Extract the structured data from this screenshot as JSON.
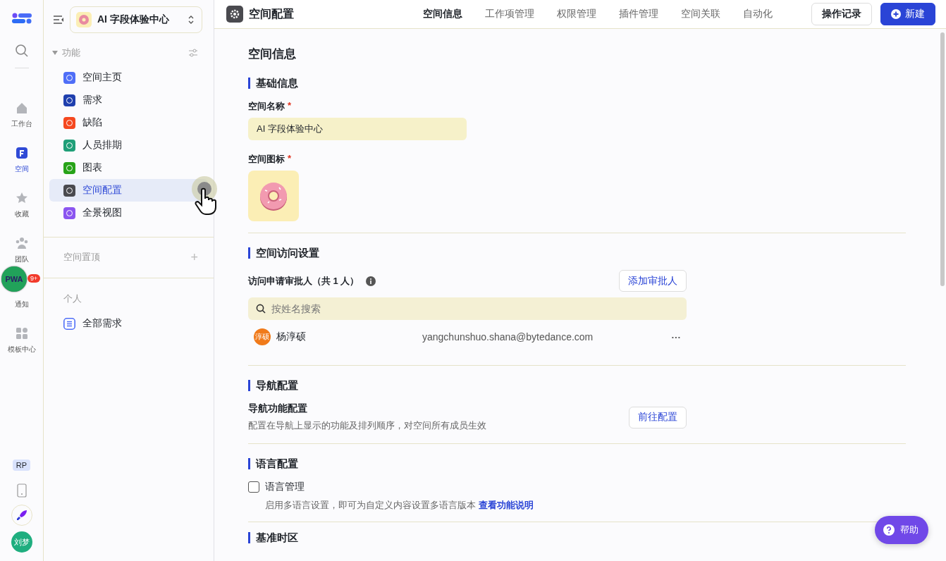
{
  "rail": {
    "items": [
      {
        "label": "工作台",
        "selected": false
      },
      {
        "label": "空间",
        "selected": true
      },
      {
        "label": "收藏",
        "selected": false
      },
      {
        "label": "团队",
        "selected": false
      },
      {
        "label": "通知",
        "selected": false,
        "badge": "9+"
      },
      {
        "label": "模板中心",
        "selected": false
      }
    ],
    "tag": "RP",
    "avatar": "刘梦"
  },
  "overlay": {
    "label": "PWA"
  },
  "space_switcher": {
    "name": "AI 字段体验中心"
  },
  "nav": {
    "sections": [
      {
        "title": "功能",
        "expanded": true,
        "items": [
          {
            "label": "空间主页",
            "kind": "filled",
            "color": "#4f6ef7",
            "selected": false
          },
          {
            "label": "需求",
            "kind": "filled",
            "color": "#1f3fae",
            "selected": false
          },
          {
            "label": "缺陷",
            "kind": "filled",
            "color": "#f5481f",
            "selected": false
          },
          {
            "label": "人员排期",
            "kind": "filled",
            "color": "#1f9f78",
            "selected": false
          },
          {
            "label": "图表",
            "kind": "filled",
            "color": "#27a318",
            "selected": false
          },
          {
            "label": "空间配置",
            "kind": "filled",
            "color": "#4a4a4f",
            "selected": true
          },
          {
            "label": "全景视图",
            "kind": "filled",
            "color": "#8b55f0",
            "selected": false
          }
        ]
      },
      {
        "title": "空间置顶",
        "action": "+"
      },
      {
        "title": "个人",
        "items": [
          {
            "label": "全部需求",
            "kind": "outline",
            "color": "#4f6ef7",
            "selected": false
          }
        ]
      }
    ]
  },
  "topbar": {
    "title": "空间配置",
    "tabs": [
      {
        "label": "空间信息",
        "selected": true
      },
      {
        "label": "工作项管理",
        "selected": false
      },
      {
        "label": "权限管理",
        "selected": false
      },
      {
        "label": "插件管理",
        "selected": false
      },
      {
        "label": "空间关联",
        "selected": false
      },
      {
        "label": "自动化",
        "selected": false
      }
    ],
    "history_button": "操作记录",
    "new_button": "新建"
  },
  "page": {
    "title": "空间信息",
    "basic": {
      "heading": "基础信息",
      "name_label": "空间名称",
      "required_mark": "*",
      "name_value": "AI 字段体验中心",
      "icon_label": "空间图标"
    },
    "access": {
      "heading": "空间访问设置",
      "approver_label": "访问申请审批人（共 1 人）",
      "add_button": "添加审批人",
      "search_placeholder": "按姓名搜索",
      "members": [
        {
          "avatar": "淳硕",
          "name": "杨淳硕",
          "email": "yangchunshuo.shana@bytedance.com",
          "more": "···"
        }
      ]
    },
    "navigation": {
      "heading": "导航配置",
      "title": "导航功能配置",
      "description": "配置在导航上显示的功能及排列顺序，对空间所有成员生效",
      "button": "前往配置"
    },
    "language": {
      "heading": "语言配置",
      "option": {
        "label": "语言管理",
        "checked": false
      },
      "description": "启用多语言设置，即可为自定义内容设置多语言版本",
      "link": "查看功能说明"
    },
    "timezone": {
      "heading": "基准时区"
    }
  },
  "help_button": "帮助"
}
